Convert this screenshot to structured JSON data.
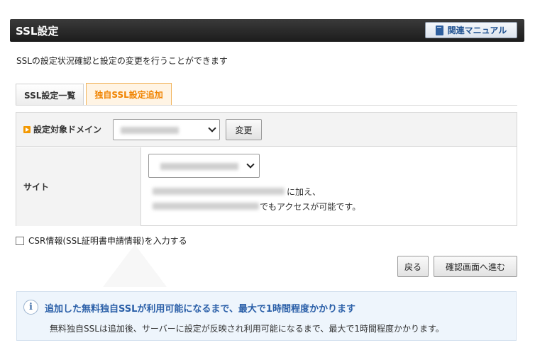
{
  "header": {
    "title": "SSL設定",
    "manual_label": "関連マニュアル"
  },
  "description": "SSLの設定状況確認と設定の変更を行うことができます",
  "tabs": [
    {
      "label": "SSL設定一覧",
      "active": false
    },
    {
      "label": "独自SSL設定追加",
      "active": true
    }
  ],
  "form": {
    "domain_label": "設定対象ドメイン",
    "change_button": "変更",
    "site_label": "サイト",
    "site_note_line1": "に加え、",
    "site_note_line2": "でもアクセスが可能です。"
  },
  "csr_checkbox_label": "CSR情報(SSL証明書申請情報)を入力する",
  "buttons": {
    "back": "戻る",
    "confirm": "確認画面へ進む"
  },
  "info": {
    "icon": "i",
    "title": "追加した無料独自SSLが利用可能になるまで、最大で1時間程度かかります",
    "body": "無料独自SSLは追加後、サーバーに設定が反映され利用可能になるまで、最大で1時間程度かかります。"
  },
  "colors": {
    "header_bg": "#262626",
    "active_tab_text": "#f08300",
    "accent_orange": "#f39800",
    "info_title": "#2a5fa8",
    "info_bg": "#eef5fc"
  }
}
